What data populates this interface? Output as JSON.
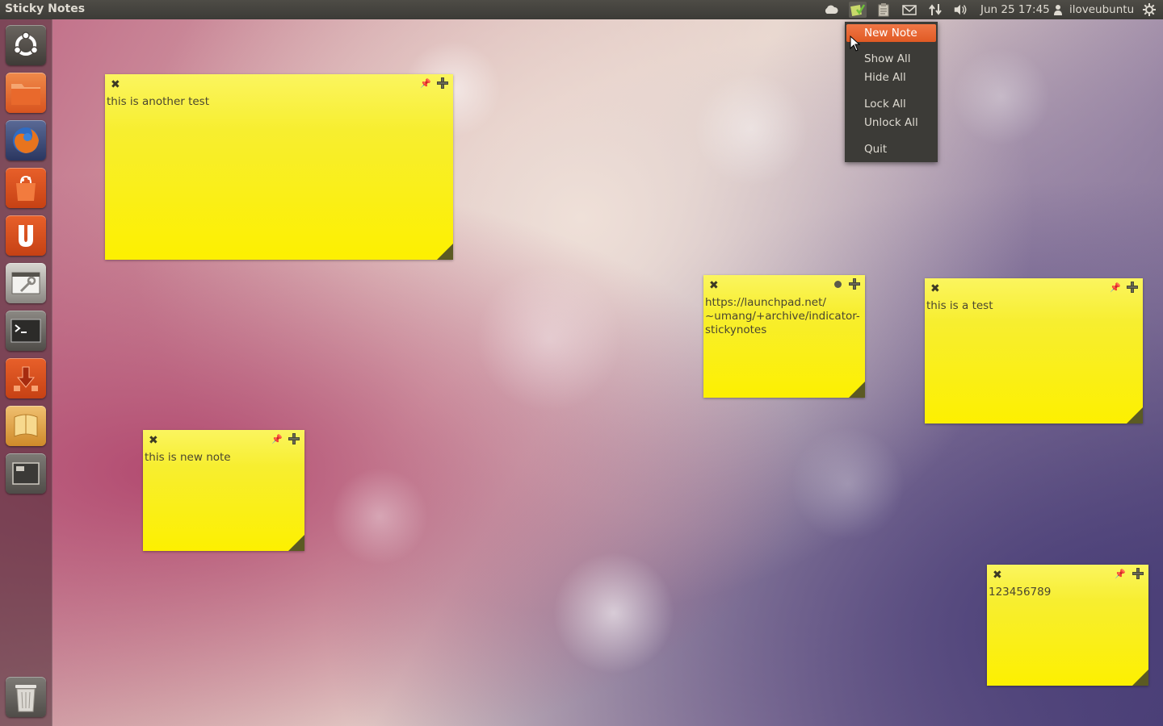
{
  "panel": {
    "app_title": "Sticky Notes",
    "clock": "Jun 25 17:45",
    "user": "iloveubuntu",
    "tray_icons": [
      "cloud-icon",
      "sticky-notes-indicator-icon",
      "clipboard-icon",
      "mail-icon",
      "network-icon",
      "volume-icon",
      "user-icon",
      "session-gear-icon"
    ]
  },
  "launcher": {
    "items": [
      "ubuntu-dash",
      "files",
      "firefox",
      "software-center",
      "ubuntu-one",
      "system-settings",
      "terminal",
      "update-manager",
      "notes-app",
      "workspace-switcher",
      "trash"
    ]
  },
  "menu": {
    "items": [
      {
        "label": "New Note",
        "active": true
      },
      {
        "label": "Show All"
      },
      {
        "label": "Hide All"
      },
      {
        "label": "Lock All"
      },
      {
        "label": "Unlock All"
      },
      {
        "label": "Quit"
      }
    ]
  },
  "notes": [
    {
      "text": "this is another test",
      "locked": false
    },
    {
      "text": "https://launchpad.net/\n~umang/+archive/indicator-\nstickynotes",
      "locked": true
    },
    {
      "text": "this is a test",
      "locked": false
    },
    {
      "text": "this is new note",
      "locked": false
    },
    {
      "text": "123456789",
      "locked": false
    }
  ],
  "colors": {
    "note_yellow": "#fdf000",
    "menu_highlight": "#e05a24",
    "panel_bg": "#3c3b37"
  }
}
